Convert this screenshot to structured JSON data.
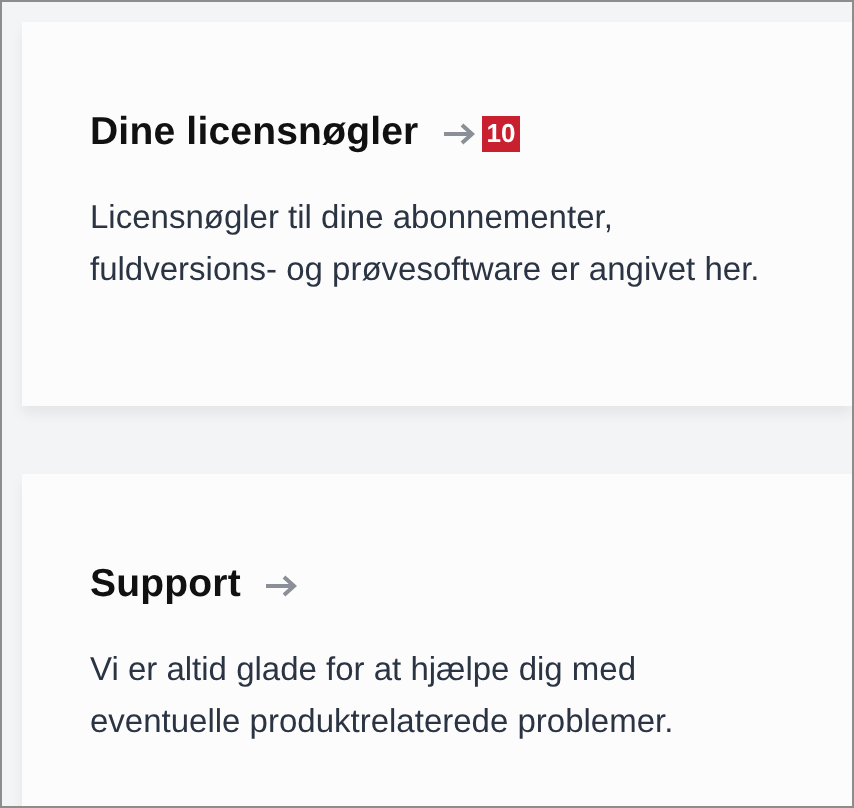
{
  "cards": [
    {
      "title": "Dine licensnøgler",
      "badge": "10",
      "description": "Licensnøgler til dine abonnementer, fuldversions- og prøvesoftware er angivet her."
    },
    {
      "title": "Support",
      "description": "Vi er altid glade for at hjælpe dig med eventuelle produktrelaterede problemer."
    }
  ]
}
